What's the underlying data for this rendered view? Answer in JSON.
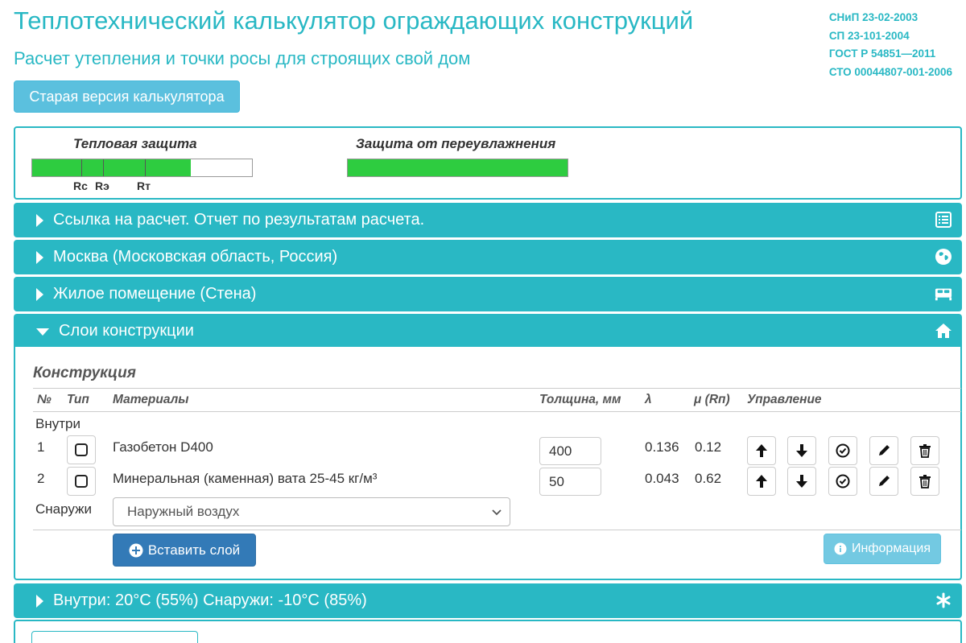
{
  "header": {
    "title": "Теплотехнический калькулятор ограждающих конструкций",
    "subtitle": "Расчет утепления и точки росы для строящих свой дом",
    "norms": [
      "СНиП 23-02-2003",
      "СП 23-101-2004",
      "ГОСТ Р 54851—2011",
      "СТО 00044807-001-2006"
    ],
    "old_version_button": "Старая версия калькулятора"
  },
  "indicators": {
    "thermal": {
      "title": "Тепловая защита",
      "fill_fraction": 0.72,
      "markers": [
        {
          "label": "Rc",
          "fraction": 0.22
        },
        {
          "label": "Rэ",
          "fraction": 0.32
        },
        {
          "label": "Rт",
          "fraction": 0.51
        }
      ]
    },
    "moisture": {
      "title": "Защита от переувлажнения",
      "fill_fraction": 1.0
    }
  },
  "accordion": [
    {
      "label": "Ссылка на расчет. Отчет по результатам расчета.",
      "icon": "list-icon",
      "expanded": false
    },
    {
      "label": "Москва (Московская область, Россия)",
      "icon": "globe-icon",
      "expanded": false
    },
    {
      "label": "Жилое помещение (Стена)",
      "icon": "bed-icon",
      "expanded": false
    },
    {
      "label": "Слои конструкции",
      "icon": "home-icon",
      "expanded": true
    },
    {
      "label": "Внутри: 20°C (55%) Снаружи: -10°C (85%)",
      "icon": "snowflake-icon",
      "expanded": false
    }
  ],
  "construction": {
    "title": "Конструкция",
    "columns": {
      "num": "№",
      "type": "Тип",
      "materials": "Материалы",
      "thickness": "Толщина, мм",
      "lambda": "λ",
      "mu": "μ (Rп)",
      "controls": "Управление"
    },
    "inside_label": "Внутри",
    "outside_label": "Снаружи",
    "layers": [
      {
        "num": "1",
        "material": "Газобетон D400",
        "thickness": "400",
        "lambda": "0.136",
        "mu": "0.12"
      },
      {
        "num": "2",
        "material": "Минеральная (каменная) вата 25-45 кг/м³",
        "thickness": "50",
        "lambda": "0.043",
        "mu": "0.62"
      }
    ],
    "outside_select": "Наружный воздух",
    "insert_button": "Вставить слой",
    "info_button": "Информация"
  },
  "colors": {
    "accent": "#29b8c4",
    "bar_fill": "#2ecc40",
    "primary_button": "#337ab7",
    "info_button": "#5bc0de"
  }
}
